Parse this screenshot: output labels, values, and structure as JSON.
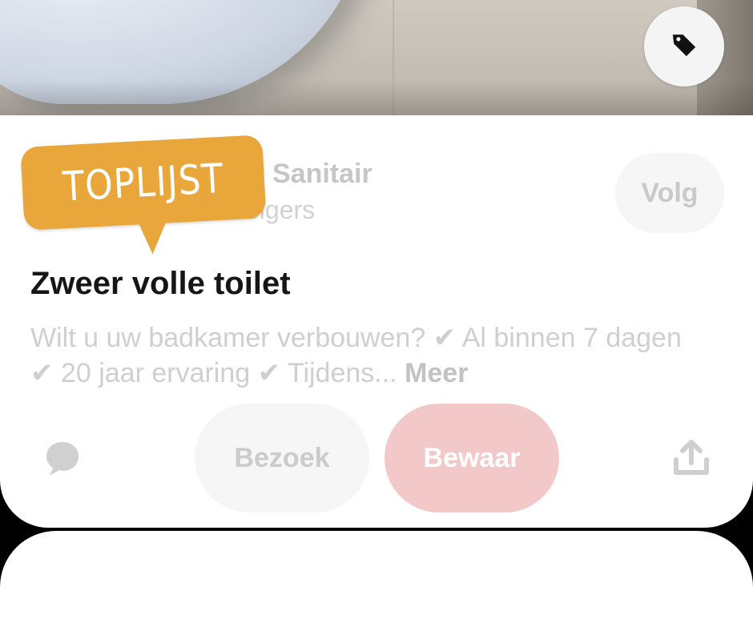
{
  "pin": {
    "profile_name": "Sanitair",
    "profile_followers": "volgers",
    "follow_label": "Volg",
    "sticker_label": "TOPLIJST",
    "title": "Zweer volle toilet",
    "description": "Wilt u uw badkamer verbouwen? ✔ Al binnen 7 dagen ✔ 20 jaar ervaring ✔ Tijdens... ",
    "more_label": "Meer"
  },
  "actions": {
    "comment_icon": "comment-icon",
    "visit_label": "Bezoek",
    "save_label": "Bewaar",
    "share_icon": "share-icon"
  },
  "image": {
    "tag_icon": "tag-icon"
  },
  "colors": {
    "save_bg": "#f3c8c9",
    "sticker": "#e9a73b",
    "title": "#161616",
    "muted_text": "#cfcfcf"
  }
}
